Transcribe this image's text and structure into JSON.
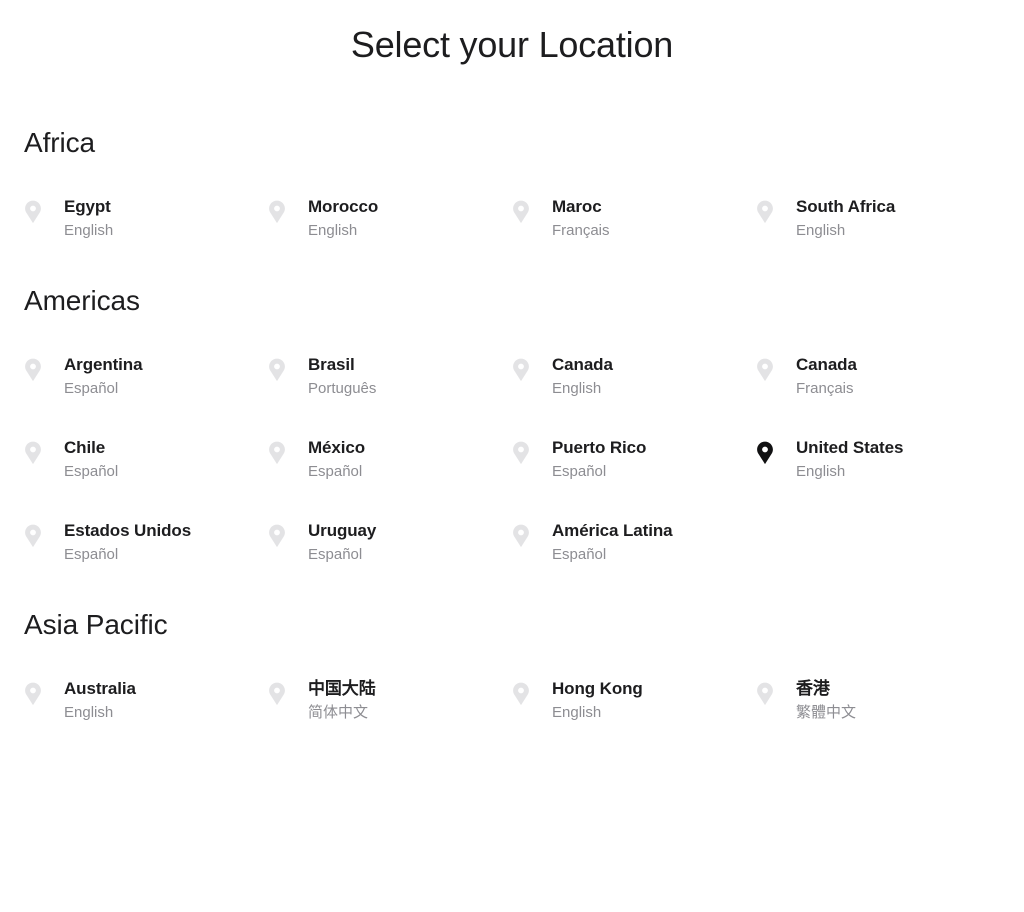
{
  "page": {
    "title": "Select your Location",
    "background_color": "#ffffff",
    "text_color": "#1d1d1f",
    "muted_text_color": "#8d8d92",
    "pin_default_color": "#e3e3e5",
    "pin_selected_color": "#111112"
  },
  "icons": {
    "pin": "map-pin-icon",
    "pin_selected": "map-pin-filled-icon"
  },
  "sections": [
    {
      "id": "africa",
      "heading": "Africa",
      "items": [
        {
          "name": "Egypt",
          "language": "English",
          "selected": false
        },
        {
          "name": "Morocco",
          "language": "English",
          "selected": false
        },
        {
          "name": "Maroc",
          "language": "Français",
          "selected": false
        },
        {
          "name": "South Africa",
          "language": "English",
          "selected": false
        }
      ]
    },
    {
      "id": "americas",
      "heading": "Americas",
      "items": [
        {
          "name": "Argentina",
          "language": "Español",
          "selected": false
        },
        {
          "name": "Brasil",
          "language": "Português",
          "selected": false
        },
        {
          "name": "Canada",
          "language": "English",
          "selected": false
        },
        {
          "name": "Canada",
          "language": "Français",
          "selected": false
        },
        {
          "name": "Chile",
          "language": "Español",
          "selected": false
        },
        {
          "name": "México",
          "language": "Español",
          "selected": false
        },
        {
          "name": "Puerto Rico",
          "language": "Español",
          "selected": false
        },
        {
          "name": "United States",
          "language": "English",
          "selected": true
        },
        {
          "name": "Estados Unidos",
          "language": "Español",
          "selected": false
        },
        {
          "name": "Uruguay",
          "language": "Español",
          "selected": false
        },
        {
          "name": "América Latina",
          "language": "Español",
          "selected": false
        }
      ]
    },
    {
      "id": "asia-pacific",
      "heading": "Asia Pacific",
      "items": [
        {
          "name": "Australia",
          "language": "English",
          "selected": false
        },
        {
          "name": "中国大陆",
          "language": "简体中文",
          "selected": false
        },
        {
          "name": "Hong Kong",
          "language": "English",
          "selected": false
        },
        {
          "name": "香港",
          "language": "繁體中文",
          "selected": false
        }
      ]
    }
  ]
}
